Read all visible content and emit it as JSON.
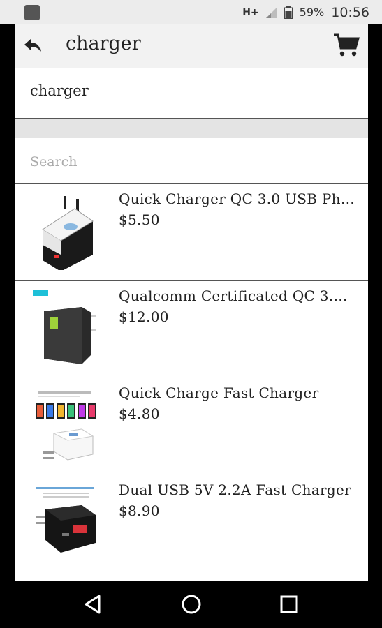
{
  "status_bar": {
    "network": "H+",
    "battery_percent": "59%",
    "time": "10:56"
  },
  "app_bar": {
    "title": "charger",
    "back_icon": "back-arrow-icon",
    "cart_icon": "cart-icon"
  },
  "query": {
    "text": "charger"
  },
  "search": {
    "placeholder": "Search"
  },
  "products": [
    {
      "title": "Quick Charger QC 3.0 USB Pho...",
      "price": "$5.50"
    },
    {
      "title": "Qualcomm Certificated QC 3.0 ...",
      "price": "$12.00"
    },
    {
      "title": "Quick Charge Fast Charger",
      "price": "$4.80"
    },
    {
      "title": "Dual USB 5V 2.2A Fast Charger",
      "price": "$8.90"
    }
  ],
  "nav_bar": {
    "back": "nav-back-icon",
    "home": "nav-home-icon",
    "recents": "nav-recents-icon"
  }
}
